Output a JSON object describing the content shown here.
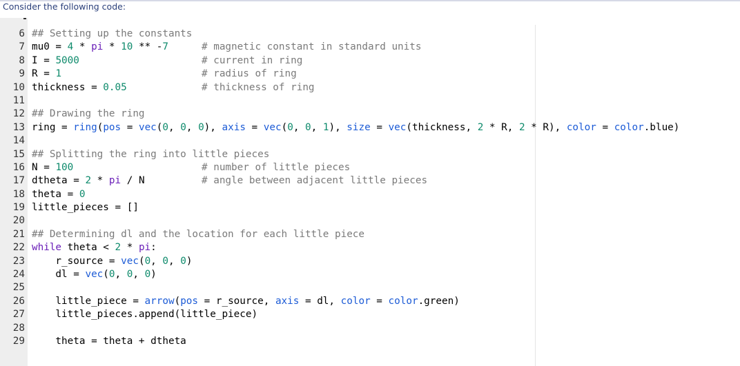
{
  "prompt": "Consider the following code:",
  "lines": [
    {
      "n": "6",
      "code": "## Setting up the constants",
      "cls": "c-gray",
      "comment": ""
    },
    {
      "n": "7",
      "code": "mu0 = 4 * pi * 10 ** -7",
      "cls": "",
      "comment": "# magnetic constant in standard units"
    },
    {
      "n": "8",
      "code": "I = 5000",
      "cls": "",
      "comment": "# current in ring"
    },
    {
      "n": "9",
      "code": "R = 1",
      "cls": "",
      "comment": "# radius of ring"
    },
    {
      "n": "10",
      "code": "thickness = 0.05",
      "cls": "",
      "comment": "# thickness of ring"
    },
    {
      "n": "11",
      "code": "",
      "cls": "",
      "comment": ""
    },
    {
      "n": "12",
      "code": "## Drawing the ring",
      "cls": "c-gray",
      "comment": ""
    },
    {
      "n": "13",
      "code": "ring = ring(pos = vec(0, 0, 0), axis = vec(0, 0, 1), size = vec(thickness, 2 * R, 2 * R), color = color.blue)",
      "cls": "",
      "comment": ""
    },
    {
      "n": "14",
      "code": "",
      "cls": "",
      "comment": ""
    },
    {
      "n": "15",
      "code": "## Splitting the ring into little pieces",
      "cls": "c-gray",
      "comment": ""
    },
    {
      "n": "16",
      "code": "N = 100",
      "cls": "",
      "comment": "# number of little pieces"
    },
    {
      "n": "17",
      "code": "dtheta = 2 * pi / N",
      "cls": "",
      "comment": "# angle between adjacent little pieces"
    },
    {
      "n": "18",
      "code": "theta = 0",
      "cls": "",
      "comment": ""
    },
    {
      "n": "19",
      "code": "little_pieces = []",
      "cls": "",
      "comment": ""
    },
    {
      "n": "20",
      "code": "",
      "cls": "",
      "comment": ""
    },
    {
      "n": "21",
      "code": "## Determining dl and the location for each little piece",
      "cls": "c-gray",
      "comment": ""
    },
    {
      "n": "22",
      "code": "while theta < 2 * pi:",
      "cls": "",
      "comment": ""
    },
    {
      "n": "23",
      "code": "    r_source = vec(0, 0, 0)",
      "cls": "",
      "comment": ""
    },
    {
      "n": "24",
      "code": "    dl = vec(0, 0, 0)",
      "cls": "",
      "comment": ""
    },
    {
      "n": "25",
      "code": "",
      "cls": "",
      "comment": ""
    },
    {
      "n": "26",
      "code": "    little_piece = arrow(pos = r_source, axis = dl, color = color.green)",
      "cls": "",
      "comment": ""
    },
    {
      "n": "27",
      "code": "    little_pieces.append(little_piece)",
      "cls": "",
      "comment": ""
    },
    {
      "n": "28",
      "code": "",
      "cls": "",
      "comment": ""
    },
    {
      "n": "29",
      "code": "    theta = theta + dtheta",
      "cls": "",
      "comment": ""
    }
  ]
}
